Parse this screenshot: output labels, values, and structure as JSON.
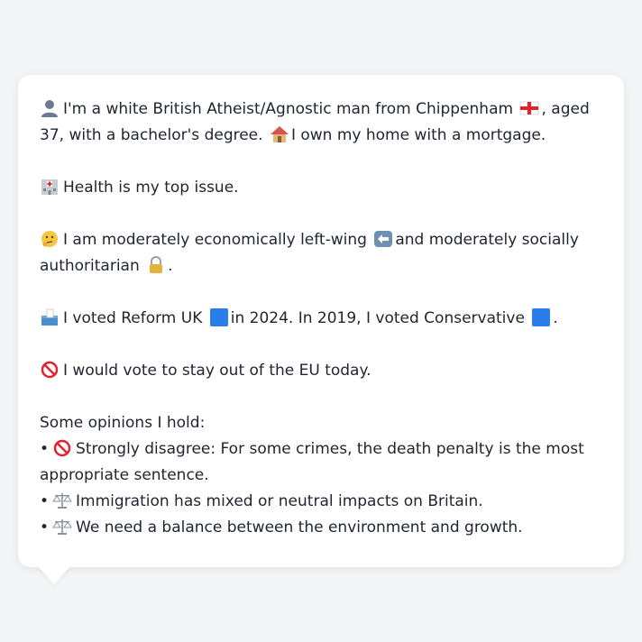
{
  "profile": {
    "intro_a": "I'm a white British Atheist/Agnostic man from Chippenham",
    "intro_b": ", aged 37, with a bachelor's degree.",
    "home": "I own my home with a mortgage.",
    "issue": "Health is my top issue.",
    "ideology_a": "I am moderately economically left-wing",
    "ideology_b": "and moderately socially authoritarian",
    "ideology_end": ".",
    "vote_a": "I voted Reform UK",
    "vote_b": "in 2024. In 2019, I voted Conservative",
    "vote_end": ".",
    "eu": "I would vote to stay out of the EU today.",
    "opinions_heading": "Some opinions I hold:",
    "opinions": [
      "Strongly disagree: For some crimes, the death penalty is the most appropriate sentence.",
      "Immigration has mixed or neutral impacts on Britain.",
      "We need a balance between the environment and growth."
    ],
    "bullet": "•"
  },
  "icons": {
    "person": "person-icon",
    "flag": "england-flag-icon",
    "house": "house-icon",
    "hospital": "hospital-icon",
    "thinking": "thinking-face-icon",
    "left_arrow": "left-arrow-icon",
    "lock": "lock-icon",
    "ballot": "ballot-box-icon",
    "no_entry": "no-entry-icon",
    "scales": "balance-scale-icon"
  },
  "colors": {
    "reform": "#2b7de9",
    "conservative": "#2b7de9"
  }
}
